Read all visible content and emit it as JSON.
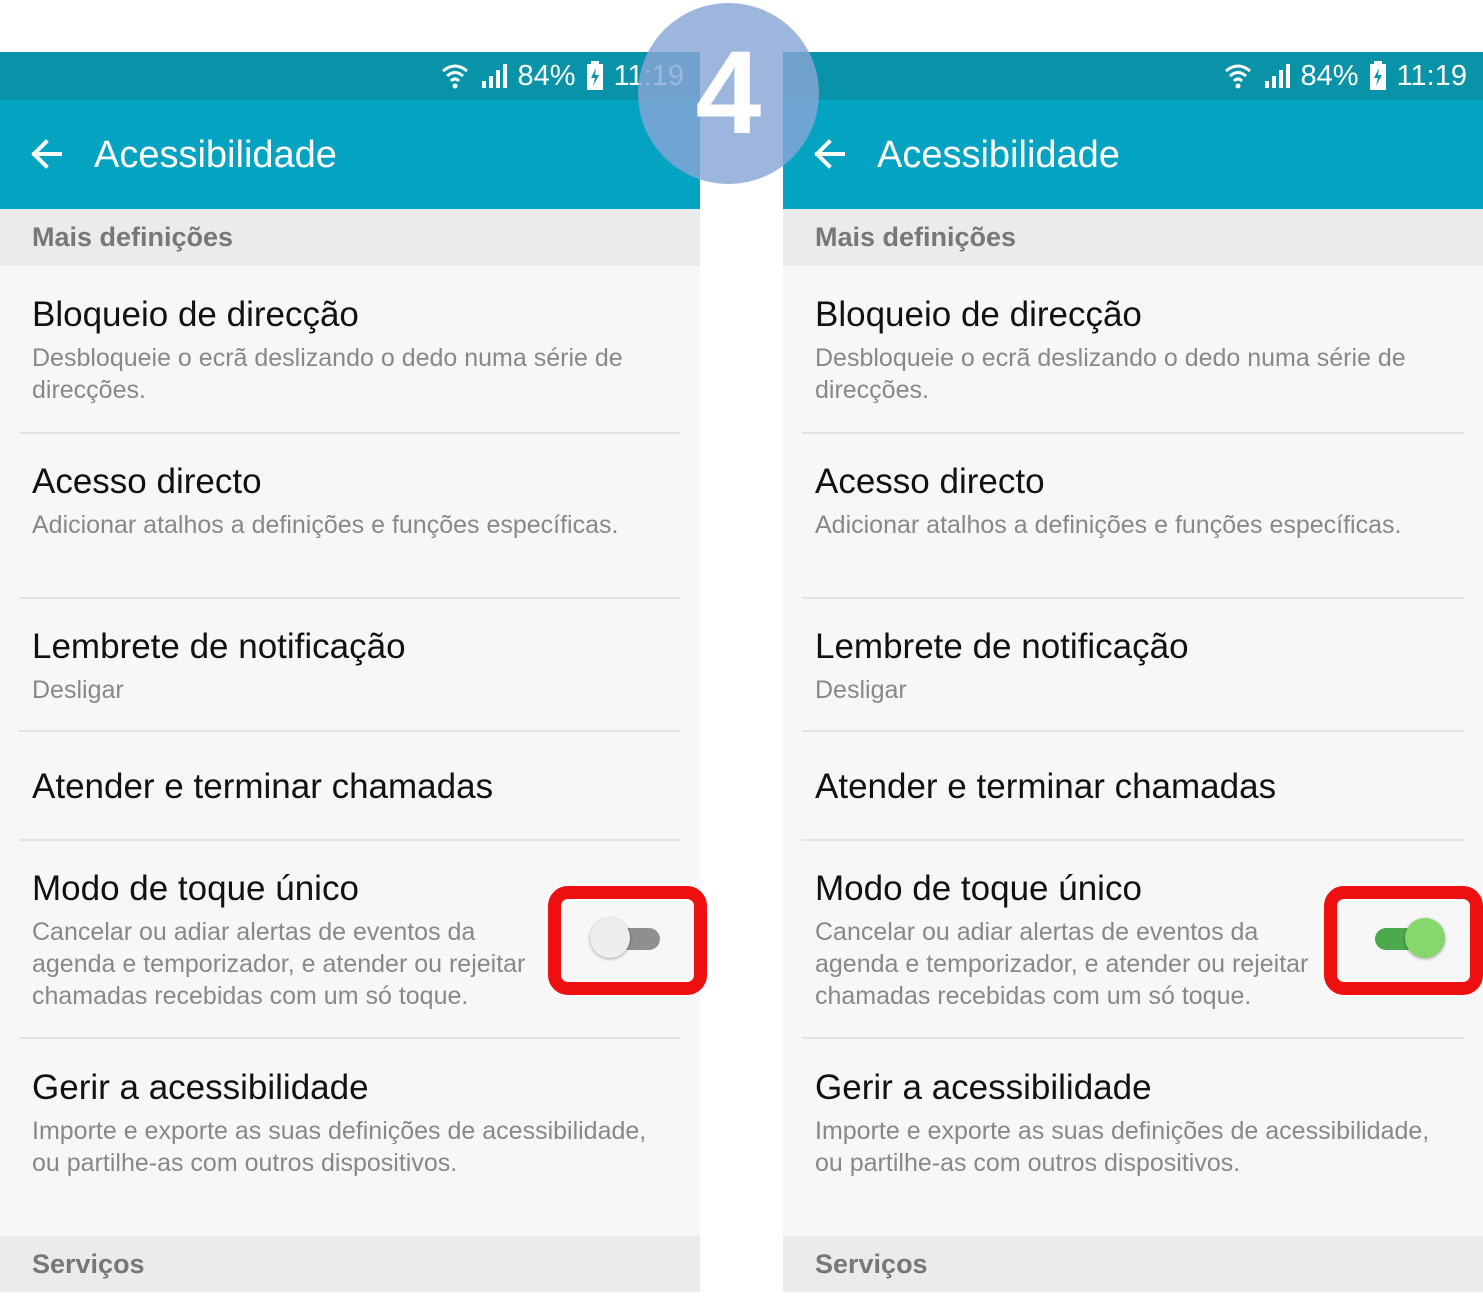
{
  "step_number": "4",
  "status_bar": {
    "battery": "84%",
    "time": "11:19"
  },
  "app_bar": {
    "title": "Acessibilidade"
  },
  "sections": {
    "more_settings": "Mais definições",
    "services": "Serviços"
  },
  "items": [
    {
      "title": "Bloqueio de direcção",
      "subtitle": "Desbloqueie o ecrã deslizando o dedo numa série de direcções."
    },
    {
      "title": "Acesso directo",
      "subtitle": "Adicionar atalhos a definições e funções específicas."
    },
    {
      "title": "Lembrete de notificação",
      "subtitle": "Desligar"
    },
    {
      "title": "Atender e terminar chamadas",
      "subtitle": ""
    },
    {
      "title": "Modo de toque único",
      "subtitle": "Cancelar ou adiar alertas de eventos da agenda e temporizador, e atender ou rejeitar chamadas recebidas com um só toque."
    },
    {
      "title": "Gerir a acessibilidade",
      "subtitle": "Importe e exporte as suas definições de acessibilidade, ou partilhe-as com outros dispositivos."
    }
  ],
  "toggle_states": {
    "left": "off",
    "right": "on"
  },
  "colors": {
    "status_bar": "#0893a8",
    "app_bar": "#03a3c1",
    "highlight": "#ee1010",
    "toggle_on": "#86d86c",
    "badge": "#87a6d6"
  },
  "icons": [
    "back-arrow-icon",
    "wifi-icon",
    "signal-icon",
    "battery-charging-icon"
  ]
}
